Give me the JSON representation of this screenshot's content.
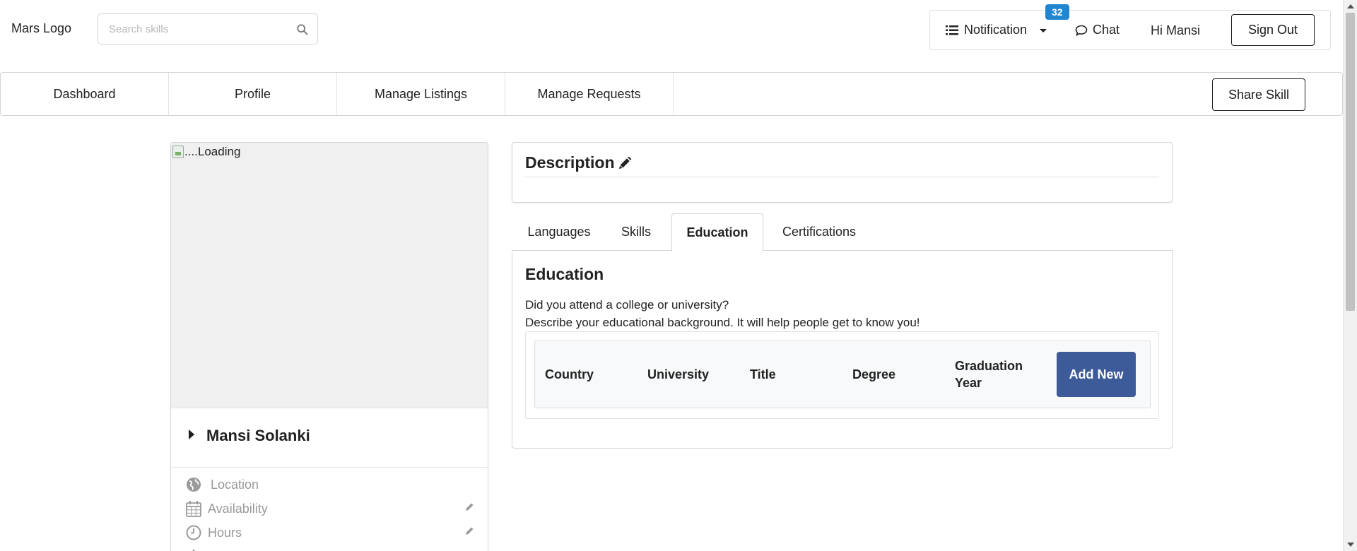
{
  "header": {
    "logo_text": "Mars Logo",
    "search_placeholder": "Search skills",
    "notification_label": "Notification",
    "notification_count": "32",
    "chat_label": "Chat",
    "greeting": "Hi Mansi",
    "signout_label": "Sign Out"
  },
  "nav": {
    "items": [
      {
        "label": "Dashboard"
      },
      {
        "label": "Profile"
      },
      {
        "label": "Manage Listings"
      },
      {
        "label": "Manage Requests"
      }
    ],
    "share_label": "Share Skill"
  },
  "profile": {
    "image_alt": "....Loading",
    "name": "Mansi Solanki",
    "details": [
      {
        "label": "Location",
        "icon": "globe-icon"
      },
      {
        "label": "Availability",
        "icon": "calendar-icon"
      },
      {
        "label": "Hours",
        "icon": "clock-icon"
      }
    ]
  },
  "description": {
    "title": "Description"
  },
  "tabs": [
    {
      "label": "Languages"
    },
    {
      "label": "Skills"
    },
    {
      "label": "Education"
    },
    {
      "label": "Certifications"
    }
  ],
  "active_tab": "Education",
  "education": {
    "title": "Education",
    "question": "Did you attend a college or university?",
    "description": "Describe your educational background. It will help people get to know you!",
    "columns": [
      "Country",
      "University",
      "Title",
      "Degree",
      "Graduation Year"
    ],
    "add_label": "Add New",
    "rows": []
  },
  "colors": {
    "accent_button": "#3d5a99",
    "badge": "#2185d0"
  }
}
